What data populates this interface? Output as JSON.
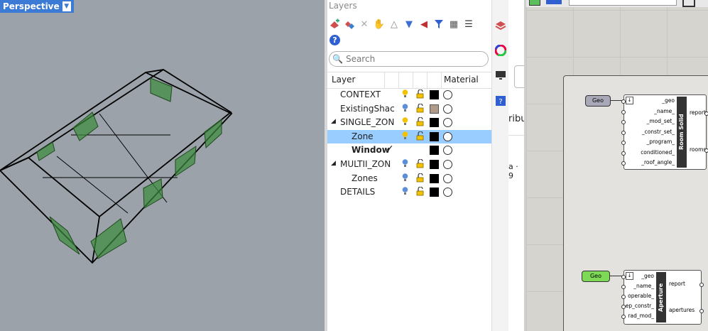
{
  "viewport": {
    "label": "Perspective",
    "dropdown": "▼"
  },
  "layers_panel": {
    "title": "Layers",
    "help": "?",
    "search_placeholder": "Search",
    "columns": {
      "layer": "Layer",
      "material": "Material"
    },
    "rows": [
      {
        "name": "CONTEXT",
        "color": "#000000"
      },
      {
        "name": "ExistingShac",
        "color": "#b09a88"
      },
      {
        "name": "SINGLE_ZON",
        "color": "#000000",
        "expand": "◢"
      },
      {
        "name": "Zone",
        "color": "#000000",
        "selected": true
      },
      {
        "name": "Window",
        "color": "#000000",
        "current": "✓"
      },
      {
        "name": "MULTII_ZON",
        "color": "#000000",
        "expand": "◢"
      },
      {
        "name": "Zones",
        "color": "#000000"
      },
      {
        "name": "DETAILS",
        "color": "#000000"
      }
    ]
  },
  "mid_panel": {
    "text1": "ribu",
    "text2": "a · 9"
  },
  "canvas": {
    "room_solid": {
      "param": "Geo",
      "title": "Room Solid",
      "inputs": [
        "_geo",
        "_name_",
        "_mod_set_",
        "_constr_set_",
        "_program_",
        "conditioned_",
        "_roof_angle_"
      ],
      "outputs": [
        "report",
        "rooms"
      ]
    },
    "aperture": {
      "param": "Geo",
      "title": "Aperture",
      "inputs": [
        "_geo",
        "_name_",
        "operable_",
        "ep_constr_",
        "rad_mod_"
      ],
      "outputs": [
        "report",
        "apertures"
      ]
    }
  },
  "colors": {
    "accent": "#3b7bd6",
    "selection": "#99ccff",
    "geo_green": "#7ed957",
    "geo_gray": "#a8a8b8"
  }
}
